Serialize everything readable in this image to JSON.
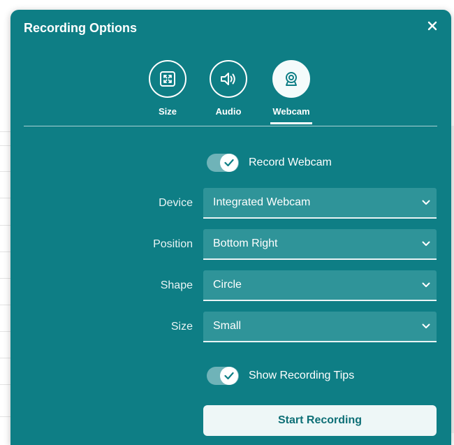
{
  "dialog": {
    "title": "Recording Options",
    "close_icon": "close-icon"
  },
  "tabs": [
    {
      "label": "Size",
      "icon": "expand-icon",
      "active": false
    },
    {
      "label": "Audio",
      "icon": "speaker-icon",
      "active": false
    },
    {
      "label": "Webcam",
      "icon": "webcam-icon",
      "active": true
    }
  ],
  "webcam": {
    "record_webcam": {
      "label": "Record Webcam",
      "checked": true
    },
    "fields": [
      {
        "label": "Device",
        "value": "Integrated Webcam"
      },
      {
        "label": "Position",
        "value": "Bottom Right"
      },
      {
        "label": "Shape",
        "value": "Circle"
      },
      {
        "label": "Size",
        "value": "Small"
      }
    ],
    "show_tips": {
      "label": "Show Recording Tips",
      "checked": true
    },
    "start_label": "Start Recording"
  },
  "colors": {
    "panel": "#0e7e85",
    "select_bg": "#2f9499",
    "button_bg": "#eef7f7",
    "button_text": "#0e6f76"
  }
}
